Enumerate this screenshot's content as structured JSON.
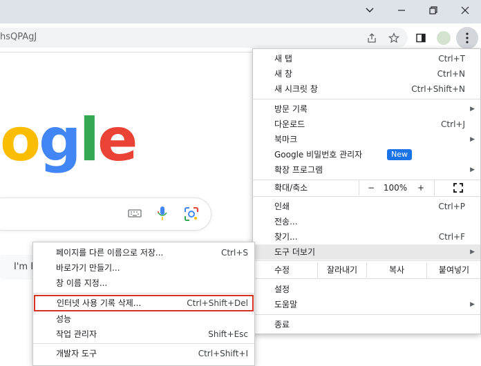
{
  "window": {
    "minimize_glyph": "⌄",
    "restore_glyph": "❐",
    "close_glyph": "✕"
  },
  "address": {
    "text": "hsQPAgJ"
  },
  "page": {
    "logo_letters": [
      "o",
      "g",
      "l",
      "e"
    ],
    "logo_colors": [
      "#fbbc04",
      "#4285f4",
      "#34a853",
      "#ea4335"
    ],
    "lucky_text": "I'm F"
  },
  "menu": {
    "new_tab": "새 탭",
    "new_tab_sc": "Ctrl+T",
    "new_window": "새 창",
    "new_window_sc": "Ctrl+N",
    "incognito": "새 시크릿 창",
    "incognito_sc": "Ctrl+Shift+N",
    "history": "방문 기록",
    "downloads": "다운로드",
    "downloads_sc": "Ctrl+J",
    "bookmarks": "북마크",
    "password_mgr": "Google 비밀번호 관리자",
    "new_badge": "New",
    "extensions": "확장 프로그램",
    "zoom_label": "확대/축소",
    "zoom_minus": "−",
    "zoom_value": "100%",
    "zoom_plus": "+",
    "print": "인쇄",
    "print_sc": "Ctrl+P",
    "cast": "전송...",
    "find": "찾기...",
    "find_sc": "Ctrl+F",
    "more_tools": "도구 더보기",
    "edit_label": "수정",
    "cut": "잘라내기",
    "copy": "복사",
    "paste": "붙여넣기",
    "settings": "설정",
    "help": "도움말",
    "exit": "종료"
  },
  "submenu": {
    "save_page": "페이지를 다른 이름으로 저장...",
    "save_page_sc": "Ctrl+S",
    "create_shortcut": "바로가기 만들기...",
    "name_window": "창 이름 지정...",
    "clear_data": "인터넷 사용 기록 삭제...",
    "clear_data_sc": "Ctrl+Shift+Del",
    "performance": "성능",
    "task_manager": "작업 관리자",
    "task_manager_sc": "Shift+Esc",
    "dev_tools": "개발자 도구",
    "dev_tools_sc": "Ctrl+Shift+I"
  },
  "colors": {
    "highlight": "#e8e8e8",
    "red_box": "#d93025",
    "blue_badge": "#1a73e8"
  }
}
